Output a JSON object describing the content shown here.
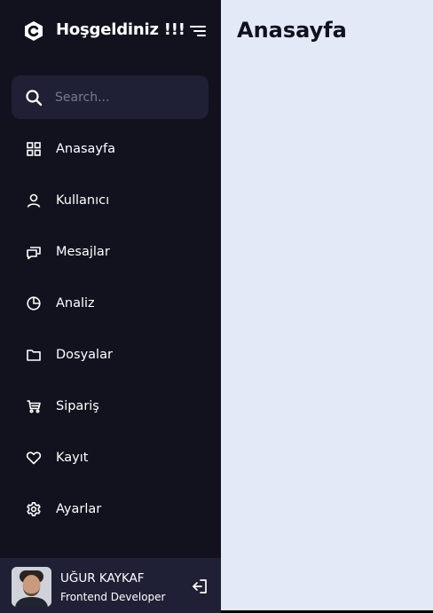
{
  "brand": {
    "title": "Hoşgeldiniz !!!",
    "logo_icon": "c-logo-icon",
    "toggle_icon": "menu-toggle-icon"
  },
  "search": {
    "placeholder": "Search...",
    "value": "",
    "icon": "search-icon"
  },
  "nav": {
    "items": [
      {
        "label": "Anasayfa",
        "icon": "grid-icon"
      },
      {
        "label": "Kullanıcı",
        "icon": "user-icon"
      },
      {
        "label": "Mesajlar",
        "icon": "chat-icon"
      },
      {
        "label": "Analiz",
        "icon": "pie-chart-icon"
      },
      {
        "label": "Dosyalar",
        "icon": "folder-icon"
      },
      {
        "label": "Sipariş",
        "icon": "cart-icon"
      },
      {
        "label": "Kayıt",
        "icon": "heart-icon"
      },
      {
        "label": "Ayarlar",
        "icon": "gear-icon"
      }
    ]
  },
  "profile": {
    "name": "UĞUR KAYKAF",
    "role": "Frontend Developer",
    "logout_icon": "logout-icon"
  },
  "main": {
    "title": "Anasayfa"
  },
  "colors": {
    "sidebar_bg": "#12121f",
    "search_bg": "#1f1f36",
    "main_bg": "#e4e9f7",
    "text_light": "#ffffff",
    "text_dark": "#11101d"
  }
}
